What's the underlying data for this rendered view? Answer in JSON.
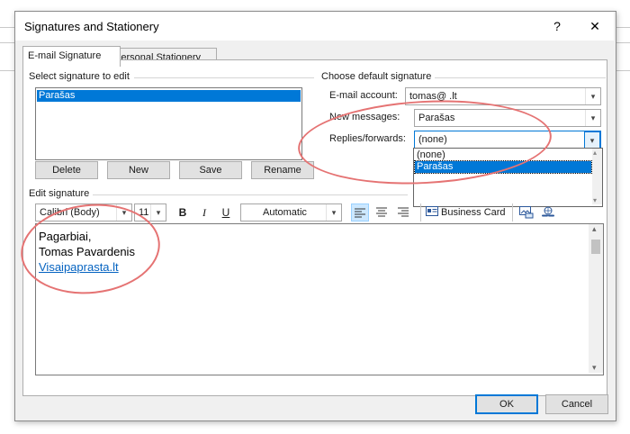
{
  "window": {
    "title": "Signatures and Stationery",
    "help_icon": "?",
    "close_icon": "✕"
  },
  "tabs": [
    {
      "label": "E-mail Signature",
      "active": true
    },
    {
      "label": "Personal Stationery",
      "active": false
    }
  ],
  "select_signature": {
    "label": "Select signature to edit",
    "items": [
      "Parašas"
    ],
    "selected": "Parašas"
  },
  "actions": {
    "delete": "Delete",
    "new": "New",
    "save": "Save",
    "rename": "Rename"
  },
  "default_signature": {
    "label": "Choose default signature",
    "email_account_label": "E-mail account:",
    "email_account_value": "tomas@            .lt",
    "new_messages_label": "New messages:",
    "new_messages_value": "Parašas",
    "replies_label": "Replies/forwards:",
    "replies_value": "(none)",
    "replies_options": [
      "(none)",
      "Parašas"
    ],
    "replies_highlighted": "Parašas"
  },
  "edit_signature": {
    "label": "Edit signature",
    "font": "Calibri (Body)",
    "size": "11",
    "bold": "B",
    "italic": "I",
    "underline": "U",
    "color": "Automatic",
    "business_card": "Business Card",
    "lines": [
      "Pagarbiai,",
      "Tomas Pavardenis"
    ],
    "link": "Visaipaprasta.lt"
  },
  "footer": {
    "ok": "OK",
    "cancel": "Cancel"
  },
  "colors": {
    "accent": "#0078d7",
    "annotation": "#e57373",
    "link": "#0563c1"
  }
}
